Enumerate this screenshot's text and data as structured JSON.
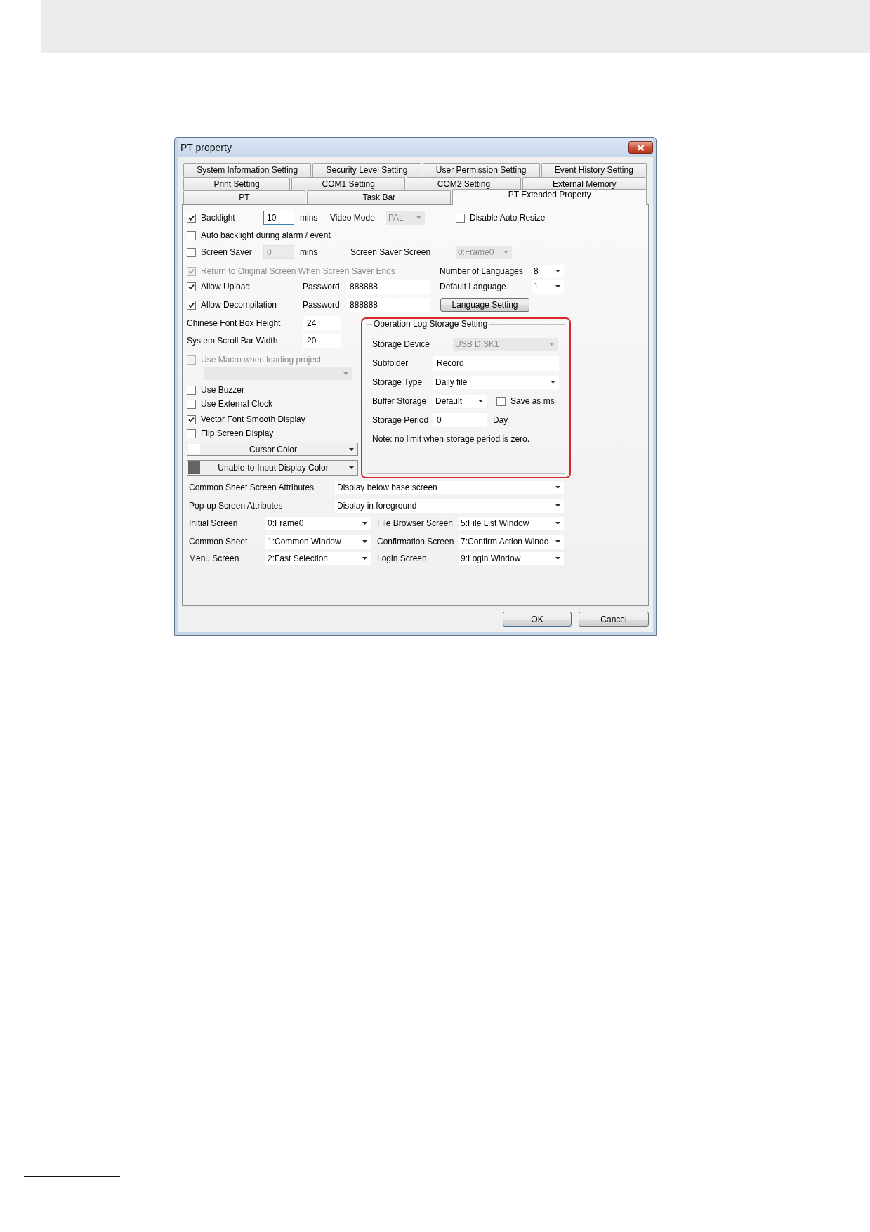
{
  "window": {
    "title": "PT property"
  },
  "tab_rows": [
    {
      "tabs": [
        {
          "label": "System Information Setting",
          "selected": false
        },
        {
          "label": "Security Level Setting",
          "selected": false
        },
        {
          "label": "User Permission Setting",
          "selected": false
        },
        {
          "label": "Event History Setting",
          "selected": false
        }
      ]
    },
    {
      "tabs": [
        {
          "label": "Print Setting",
          "selected": false
        },
        {
          "label": "COM1 Setting",
          "selected": false
        },
        {
          "label": "COM2 Setting",
          "selected": false
        },
        {
          "label": "External Memory",
          "selected": false
        }
      ]
    },
    {
      "tabs": [
        {
          "label": "PT",
          "selected": false
        },
        {
          "label": "Task Bar",
          "selected": false
        },
        {
          "label": "PT Extended Property",
          "selected": true
        }
      ]
    }
  ],
  "general": {
    "backlight": {
      "label": "Backlight",
      "checked": true
    },
    "backlight_time": {
      "value": "10",
      "focused": true,
      "unit": "mins"
    },
    "video_mode": {
      "label": "Video Mode",
      "value": "PAL",
      "disabled": true
    },
    "disable_auto_resize": {
      "label": "Disable Auto Resize",
      "checked": false
    },
    "auto_backlight": {
      "label": "Auto backlight during alarm / event",
      "checked": false
    },
    "screen_saver": {
      "label": "Screen Saver",
      "checked": false
    },
    "screen_saver_time": {
      "value": "0",
      "disabled": true,
      "unit": "mins"
    },
    "screen_saver_screen": {
      "label": "Screen Saver Screen",
      "value": "0:Frame0",
      "disabled": true
    },
    "return_to_original": {
      "label": "Return to Original Screen When Screen Saver Ends",
      "checked": true,
      "disabled": true
    },
    "number_of_languages": {
      "label": "Number of Languages",
      "value": "8"
    },
    "allow_upload": {
      "label": "Allow Upload",
      "checked": true,
      "password_label": "Password",
      "password": "888888"
    },
    "default_language": {
      "label": "Default Language",
      "value": "1"
    },
    "allow_decompilation": {
      "label": "Allow Decompilation",
      "checked": true,
      "password_label": "Password",
      "password": "888888"
    },
    "language_setting_button": {
      "label": "Language Setting"
    }
  },
  "left_column": {
    "chinese_font_box_height": {
      "label": "Chinese Font Box Height",
      "value": "24"
    },
    "system_scroll_bar_width": {
      "label": "System Scroll Bar Width",
      "value": "20"
    },
    "use_macro": {
      "label": "Use Macro when loading project",
      "checked": false,
      "disabled": true
    },
    "macro_dropdown": {
      "disabled": true
    },
    "options": [
      {
        "label": "Use Buzzer",
        "checked": false
      },
      {
        "label": "Use External Clock",
        "checked": false
      },
      {
        "label": "Vector Font Smooth Display",
        "checked": true
      },
      {
        "label": "Flip Screen Display",
        "checked": false
      }
    ],
    "color_pickers": [
      {
        "label": "Cursor Color",
        "color": "#ffffff"
      },
      {
        "label": "Unable-to-Input Display Color",
        "color": "#646464"
      }
    ]
  },
  "operation_log": {
    "title": "Operation Log Storage Setting",
    "highlighted": true,
    "storage_device": {
      "label": "Storage Device",
      "value": "USB DISK1",
      "disabled": true
    },
    "subfolder": {
      "label": "Subfolder",
      "value": "Record"
    },
    "storage_type": {
      "label": "Storage Type",
      "value": "Daily file"
    },
    "buffer_storage": {
      "label": "Buffer Storage",
      "value": "Default"
    },
    "save_as_ms": {
      "label": "Save as ms",
      "checked": false
    },
    "storage_period": {
      "label": "Storage Period",
      "value": "0",
      "unit": "Day"
    },
    "note": "Note: no limit when storage period is zero."
  },
  "screen_attributes": [
    {
      "label": "Common Sheet Screen Attributes",
      "value": "Display below base screen"
    },
    {
      "label": "Pop-up Screen Attributes",
      "value": "Display in foreground"
    }
  ],
  "screen_rows": [
    {
      "items": [
        {
          "label": "Initial Screen",
          "value": "0:Frame0"
        },
        {
          "label": "File Browser Screen",
          "value": "5:File List Window"
        }
      ]
    },
    {
      "items": [
        {
          "label": "Common Sheet",
          "value": "1:Common Window"
        },
        {
          "label": "Confirmation Screen",
          "value": "7:Confirm Action Windo"
        }
      ]
    },
    {
      "items": [
        {
          "label": "Menu Screen",
          "value": "2:Fast Selection"
        },
        {
          "label": "Login Screen",
          "value": "9:Login Window"
        }
      ]
    }
  ],
  "buttons": [
    {
      "label": "OK"
    },
    {
      "label": "Cancel"
    }
  ]
}
